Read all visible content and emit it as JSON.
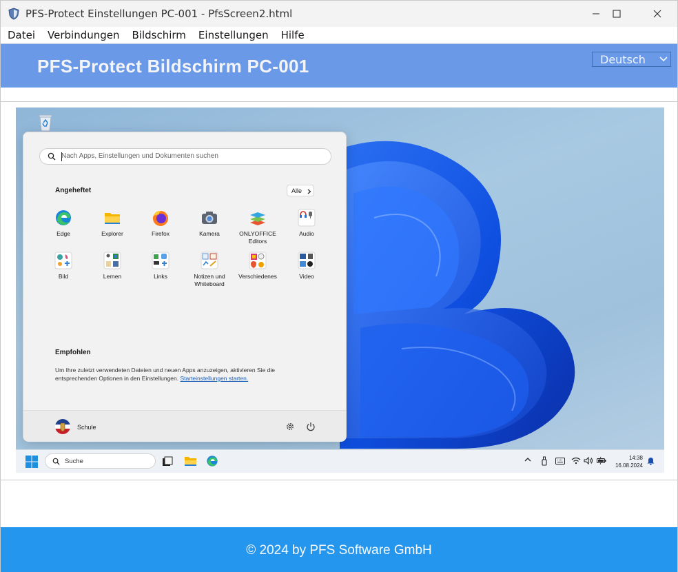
{
  "window": {
    "title": "PFS-Protect Einstellungen  PC-001 - PfsScreen2.html",
    "controls": [
      "minimize",
      "maximize",
      "close"
    ]
  },
  "menu": {
    "items": [
      "Datei",
      "Verbindungen",
      "Bildschirm",
      "Einstellungen",
      "Hilfe"
    ]
  },
  "header": {
    "title": "PFS-Protect Bildschirm PC-001",
    "language": "Deutsch"
  },
  "start_menu": {
    "search_placeholder": "Nach Apps, Einstellungen und Dokumenten suchen",
    "pinned_heading": "Angeheftet",
    "all_button": "Alle",
    "apps": [
      {
        "label": "Edge",
        "icon": "edge-icon"
      },
      {
        "label": "Explorer",
        "icon": "folder-icon"
      },
      {
        "label": "Firefox",
        "icon": "firefox-icon"
      },
      {
        "label": "Kamera",
        "icon": "camera-icon"
      },
      {
        "label": "ONLYOFFICE Editors",
        "icon": "onlyoffice-icon"
      },
      {
        "label": "Audio",
        "icon": "audio-folder-icon"
      },
      {
        "label": "Bild",
        "icon": "image-folder-icon"
      },
      {
        "label": "Lernen",
        "icon": "learn-folder-icon"
      },
      {
        "label": "Links",
        "icon": "links-folder-icon"
      },
      {
        "label": "Notizen und Whiteboard",
        "icon": "notes-folder-icon"
      },
      {
        "label": "Verschiedenes",
        "icon": "misc-folder-icon"
      },
      {
        "label": "Video",
        "icon": "video-folder-icon"
      }
    ],
    "recommended_heading": "Empfohlen",
    "recommended_text": "Um Ihre zuletzt verwendeten Dateien und neuen Apps anzuzeigen, aktivieren Sie die entsprechenden Optionen in den Einstellungen.",
    "recommended_link": "Starteinstellungen starten.",
    "user_name": "Schule"
  },
  "taskbar": {
    "search_label": "Suche",
    "time": "14:38",
    "date": "16.08.2024"
  },
  "footer": {
    "text": "© 2024 by PFS Software GmbH"
  },
  "colors": {
    "header_bg": "#6a99e8",
    "footer_bg": "#2596ee",
    "accent": "#1a5fb4"
  }
}
